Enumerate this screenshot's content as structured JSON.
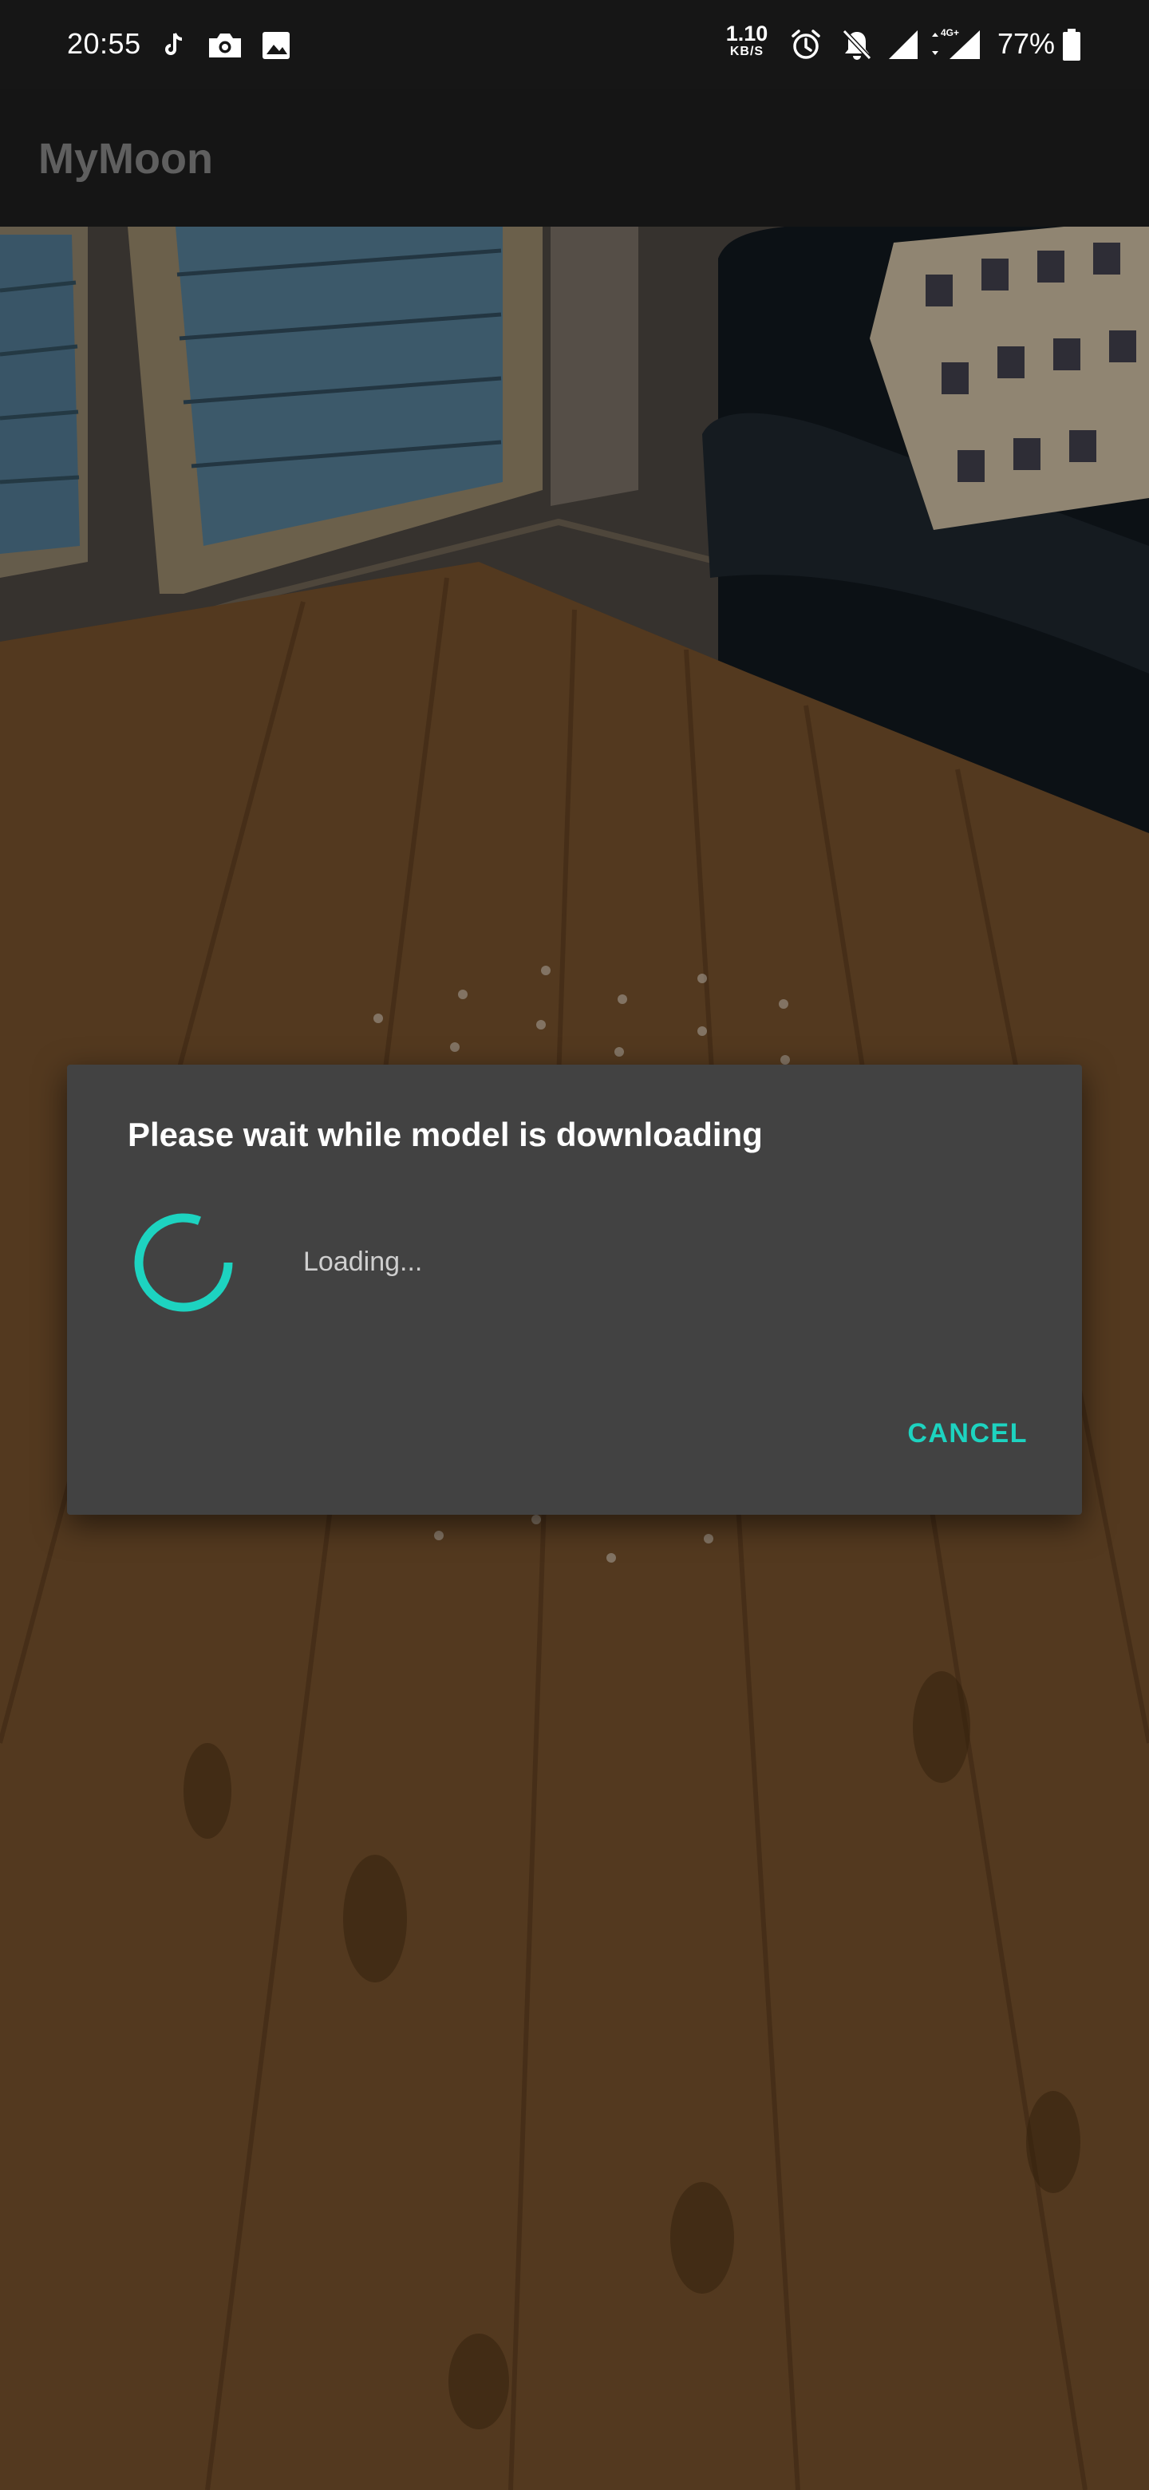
{
  "status_bar": {
    "time": "20:55",
    "notification_icons": [
      "tiktok-icon",
      "camera-icon",
      "image-icon"
    ],
    "net_speed_value": "1.10",
    "net_speed_unit": "KB/S",
    "network_type": "4G+",
    "battery_percent": "77%",
    "system_icons": [
      "alarm-icon",
      "bell-off-icon",
      "signal-icon",
      "signal-4g-icon",
      "battery-icon"
    ]
  },
  "app_bar": {
    "title": "MyMoon"
  },
  "dialog": {
    "title": "Please wait while model is downloading",
    "message": "Loading...",
    "cancel_label": "CANCEL"
  },
  "colors": {
    "accent": "#1dd3c0",
    "dialog_background": "#424242",
    "app_bar_background": "#151515",
    "app_title": "#5f5f5f"
  }
}
